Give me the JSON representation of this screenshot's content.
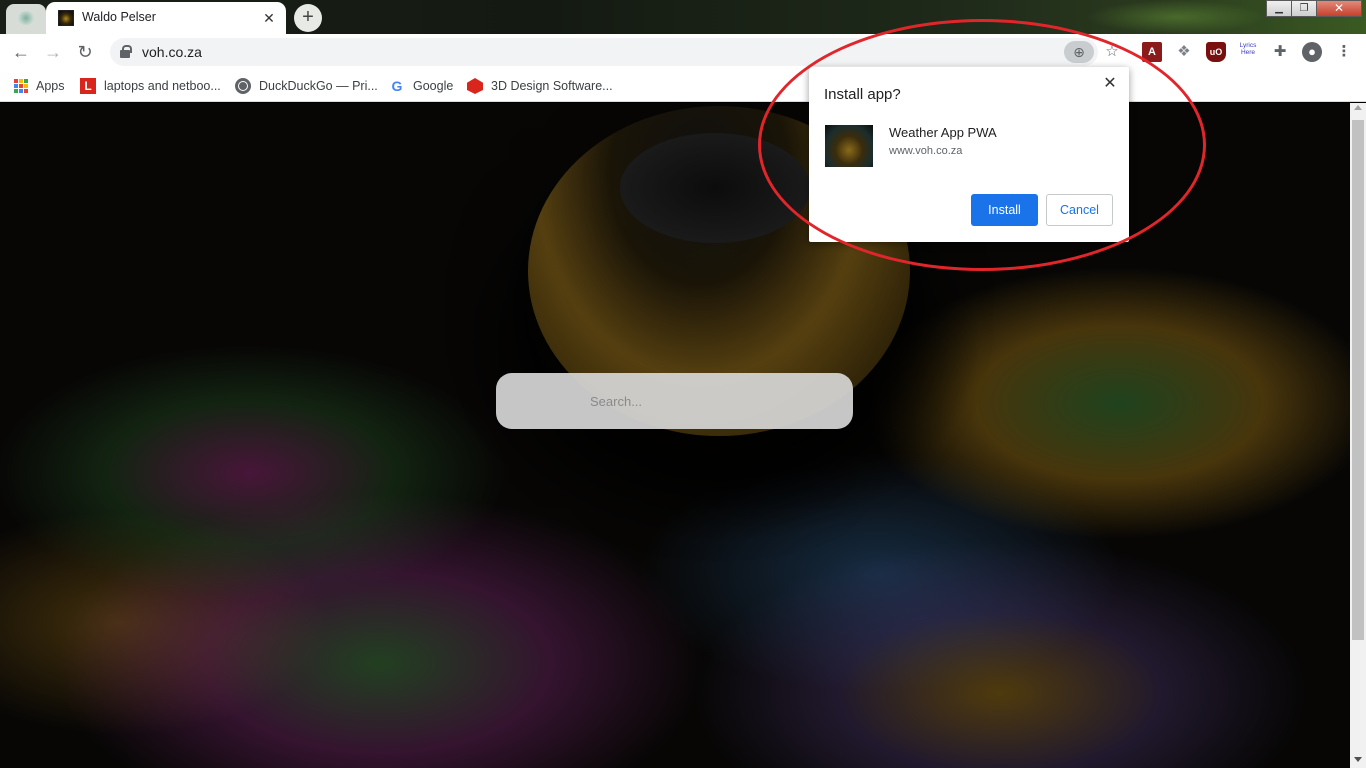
{
  "browser": {
    "active_tab_title": "Waldo Pelser",
    "tab_close_glyph": "✕",
    "new_tab_glyph": "+",
    "window_controls": {
      "minimize": "▁",
      "restore": "❐",
      "close": "✕"
    }
  },
  "toolbar": {
    "url": "voh.co.za",
    "back_glyph": "←",
    "forward_glyph": "→",
    "reload_glyph": "↻",
    "extensions": {
      "pdf": "A",
      "ublock": "uO",
      "lyrics": "Lyrics Here"
    }
  },
  "bookmarks": [
    {
      "label": "Apps",
      "icon": "apps-grid-icon"
    },
    {
      "label": "laptops and netboo...",
      "icon": "laptop-store-icon",
      "glyph": "L"
    },
    {
      "label": "DuckDuckGo — Pri...",
      "icon": "globe-icon"
    },
    {
      "label": "Google",
      "icon": "google-icon",
      "glyph": "G"
    },
    {
      "label": "3D Design Software...",
      "icon": "sketchup-icon"
    }
  ],
  "page": {
    "search_placeholder": "Search..."
  },
  "install_dialog": {
    "title": "Install app?",
    "close_glyph": "✕",
    "app_name": "Weather App PWA",
    "app_url": "www.voh.co.za",
    "install_label": "Install",
    "cancel_label": "Cancel"
  },
  "colors": {
    "accent_blue": "#1a73e8",
    "annotation_red": "#e0262b",
    "apps_grid": [
      "#ea4335",
      "#fbbc05",
      "#34a853",
      "#4285f4",
      "#ea4335",
      "#fbbc05",
      "#34a853",
      "#4285f4",
      "#ea4335"
    ]
  }
}
